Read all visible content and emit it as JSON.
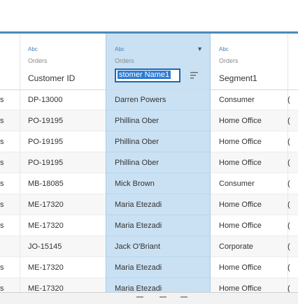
{
  "columns": [
    {
      "type_icon": "Abc",
      "source": "Orders",
      "name": "Customer ID"
    },
    {
      "type_icon": "Abc",
      "source": "Orders",
      "name": "stomer Name1"
    },
    {
      "type_icon": "Abc",
      "source": "Orders",
      "name": "Segment1"
    }
  ],
  "rows": [
    {
      "left": "s",
      "customer_id": "DP-13000",
      "customer_name": "Darren Powers",
      "segment": "Consumer",
      "right": "("
    },
    {
      "left": "s",
      "customer_id": "PO-19195",
      "customer_name": "Phillina Ober",
      "segment": "Home Office",
      "right": "("
    },
    {
      "left": "s",
      "customer_id": "PO-19195",
      "customer_name": "Phillina Ober",
      "segment": "Home Office",
      "right": "("
    },
    {
      "left": "s",
      "customer_id": "PO-19195",
      "customer_name": "Phillina Ober",
      "segment": "Home Office",
      "right": "("
    },
    {
      "left": "s",
      "customer_id": "MB-18085",
      "customer_name": "Mick Brown",
      "segment": "Consumer",
      "right": "("
    },
    {
      "left": "s",
      "customer_id": "ME-17320",
      "customer_name": "Maria Etezadi",
      "segment": "Home Office",
      "right": "("
    },
    {
      "left": "s",
      "customer_id": "ME-17320",
      "customer_name": "Maria Etezadi",
      "segment": "Home Office",
      "right": "("
    },
    {
      "left": "",
      "customer_id": "JO-15145",
      "customer_name": "Jack O'Briant",
      "segment": "Corporate",
      "right": "("
    },
    {
      "left": "s",
      "customer_id": "ME-17320",
      "customer_name": "Maria Etezadi",
      "segment": "Home Office",
      "right": "("
    },
    {
      "left": "s",
      "customer_id": "ME-17320",
      "customer_name": "Maria Etezadi",
      "segment": "Home Office",
      "right": "("
    }
  ],
  "colors": {
    "accent": "#4a8ab5",
    "selected_column": "#c9e1f3",
    "rename_highlight": "#2f7bd4"
  },
  "icons": {
    "sort": "sort-lines-icon",
    "menu": "chevron-down-icon"
  }
}
